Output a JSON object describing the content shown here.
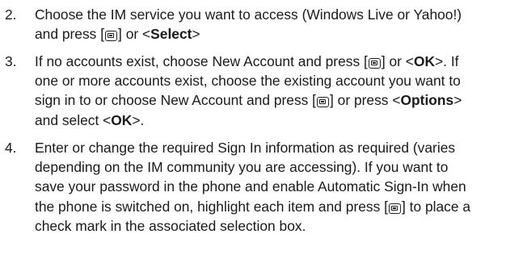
{
  "steps": [
    {
      "number": "2.",
      "lines": [
        [
          "Choose the IM service you want to access (Windows Live or Yahoo!)"
        ],
        [
          "and press [",
          "{key}",
          "] or <",
          "*Select",
          ">"
        ]
      ]
    },
    {
      "number": "3.",
      "lines": [
        [
          "If no accounts exist, choose New Account and press [",
          "{key}",
          "] or <",
          "*OK",
          ">. If"
        ],
        [
          "one or more accounts exist, choose the existing account you want to"
        ],
        [
          "sign in to or choose New Account and press [",
          "{key}",
          "] or press <",
          "*Options",
          ">"
        ],
        [
          "and select <",
          "*OK",
          ">."
        ]
      ]
    },
    {
      "number": "4.",
      "lines": [
        [
          "Enter or change the required Sign In information as required (varies"
        ],
        [
          "depending on the IM community you are accessing). If you want to"
        ],
        [
          "save your password in the phone and enable Automatic Sign-In when"
        ],
        [
          "the phone is switched on, highlight each item and press [",
          "{key}",
          "] to place a"
        ],
        [
          "check mark in the associated selection box."
        ]
      ]
    }
  ],
  "icons": {
    "key": "select-key-icon"
  }
}
